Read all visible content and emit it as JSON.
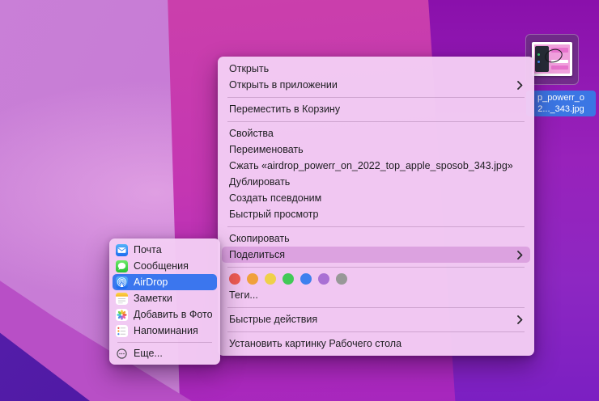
{
  "desktop": {
    "file_icon": {
      "selected": true,
      "label_line1": "p_powerr_o",
      "label_line2": "2..._343.jpg"
    }
  },
  "context_menu": {
    "items": [
      {
        "label": "Открыть",
        "has_submenu": false
      },
      {
        "label": "Открыть в приложении",
        "has_submenu": true
      },
      {
        "label": "Переместить в Корзину",
        "has_submenu": false
      },
      {
        "label": "Свойства",
        "has_submenu": false
      },
      {
        "label": "Переименовать",
        "has_submenu": false
      },
      {
        "label": "Сжать «airdrop_powerr_on_2022_top_apple_sposob_343.jpg»",
        "has_submenu": false
      },
      {
        "label": "Дублировать",
        "has_submenu": false
      },
      {
        "label": "Создать псевдоним",
        "has_submenu": false
      },
      {
        "label": "Быстрый просмотр",
        "has_submenu": false
      },
      {
        "label": "Скопировать",
        "has_submenu": false
      },
      {
        "label": "Поделиться",
        "has_submenu": true,
        "highlighted": true
      },
      {
        "label": "Теги...",
        "has_submenu": false
      },
      {
        "label": "Быстрые действия",
        "has_submenu": true
      },
      {
        "label": "Установить картинку Рабочего стола",
        "has_submenu": false
      }
    ]
  },
  "tags": {
    "colors": [
      "#ee5b52",
      "#f0a03c",
      "#efd04a",
      "#42c957",
      "#3e80ee",
      "#a970d4",
      "#989898"
    ]
  },
  "share_submenu": {
    "items": [
      {
        "label": "Почта",
        "icon": "mail-app-icon"
      },
      {
        "label": "Сообщения",
        "icon": "messages-app-icon"
      },
      {
        "label": "AirDrop",
        "icon": "airdrop-app-icon",
        "highlighted": true
      },
      {
        "label": "Заметки",
        "icon": "notes-app-icon"
      },
      {
        "label": "Добавить в Фото",
        "icon": "photos-app-icon"
      },
      {
        "label": "Напоминания",
        "icon": "reminders-app-icon"
      },
      {
        "label": "Еще...",
        "icon": "more-icon"
      }
    ]
  },
  "colors": {
    "selection_blue": "#3b76ee",
    "share_row_highlight": "#dca2e0",
    "menu_background": "#f3ccf4",
    "filename_badge_blue": "#3b76e4"
  }
}
